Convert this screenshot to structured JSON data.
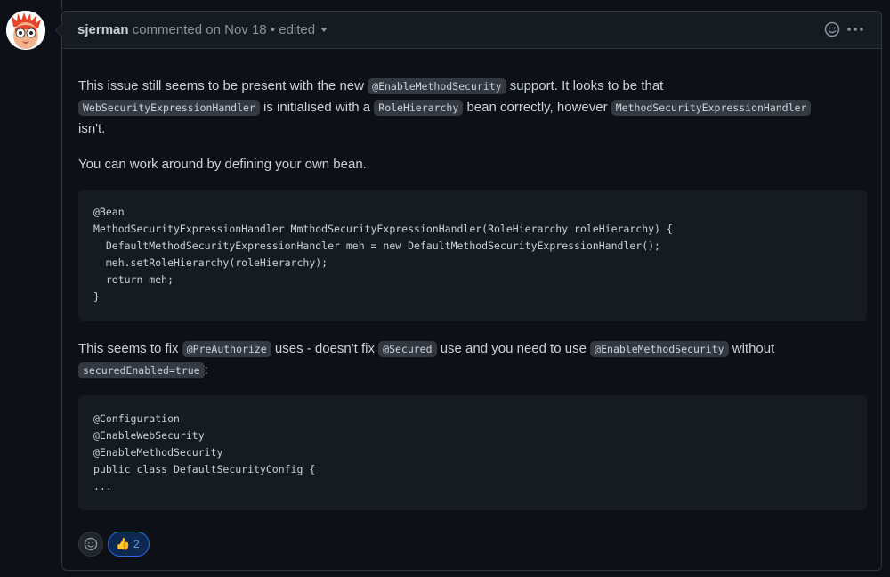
{
  "comment": {
    "author": "sjerman",
    "meta": "commented on Nov 18 • edited",
    "paragraph1": {
      "t1": "This issue still seems to be present with the new ",
      "c1": "@EnableMethodSecurity",
      "t2": " support. It looks to be that ",
      "c2": "WebSecurityExpressionHandler",
      "t3": " is initialised with a ",
      "c3": "RoleHierarchy",
      "t4": " bean correctly, however ",
      "c4": "MethodSecurityExpressionHandler",
      "t5": " isn't."
    },
    "paragraph2": "You can work around by defining your own bean.",
    "code1": [
      "@Bean",
      "MethodSecurityExpressionHandler MmthodSecurityExpressionHandler(RoleHierarchy roleHierarchy) {",
      "  DefaultMethodSecurityExpressionHandler meh = new DefaultMethodSecurityExpressionHandler();",
      "  meh.setRoleHierarchy(roleHierarchy);",
      "  return meh;",
      "}"
    ],
    "paragraph3": {
      "t1": "This seems to fix ",
      "c1": "@PreAuthorize",
      "t2": " uses - doesn't fix ",
      "c2": "@Secured",
      "t3": " use and you need to use ",
      "c3": "@EnableMethodSecurity",
      "t4": " without ",
      "c4": "securedEnabled=true",
      "t5": ":"
    },
    "code2": [
      "@Configuration",
      "@EnableWebSecurity",
      "@EnableMethodSecurity",
      "public class DefaultSecurityConfig {",
      "..."
    ],
    "reactions": {
      "thumbs_up_emoji": "👍",
      "thumbs_up_count": "2"
    }
  },
  "icons": {
    "add_reaction": "smiley-icon",
    "more": "kebab-horizontal-icon",
    "avatar": "beaker-avatar"
  },
  "colors": {
    "background": "#0d1117",
    "header": "#161b22",
    "border": "#30363d",
    "accent": "#1f6feb",
    "text": "#c9d1d9",
    "muted": "#8b949e"
  }
}
